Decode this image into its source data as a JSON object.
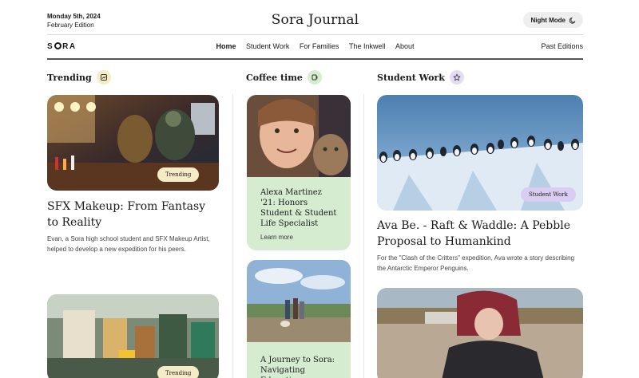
{
  "header": {
    "date": "Monday 5th, 2024",
    "edition": "February Edition",
    "title": "Sora Journal",
    "night_mode_label": "Night Mode"
  },
  "nav": {
    "logo": "SORA",
    "links": [
      "Home",
      "Student Work",
      "For Families",
      "The Inkwell",
      "About"
    ],
    "active": "Home",
    "past_editions": "Past Editions"
  },
  "columns": {
    "trending": {
      "title": "Trending",
      "cards": [
        {
          "tag": "Trending",
          "headline": "SFX Makeup: From Fantasy to Reality",
          "dek": "Evan, a Sora high school student and SFX Makeup Artist, helped to develop a new expedition for his peers."
        },
        {
          "tag": "Trending"
        }
      ]
    },
    "coffee": {
      "title": "Coffee time",
      "cards": [
        {
          "headline": "Alexa Martinez '21: Honors Student & Student Life Specialist",
          "link": "Learn more"
        },
        {
          "headline": "A Journey to Sora: Navigating Educatio"
        }
      ]
    },
    "student_work": {
      "title": "Student Work",
      "cards": [
        {
          "tag": "Student Work",
          "headline": "Ava Be. - Raft & Waddle: A Pebble Proposal to Humankind",
          "dek": "For the \"Clash of the Critters\" expedition, Ava wrote a story describing the Antarctic Emperor Penguins."
        }
      ]
    }
  },
  "colors": {
    "green_card": "#d6ecd1",
    "trending_badge": "#f4ecc4",
    "coffee_badge": "#d6ecd1",
    "student_badge": "#e4dcf4",
    "trending_tag": "#f5ebc6",
    "student_tag": "#d9cdf2"
  }
}
